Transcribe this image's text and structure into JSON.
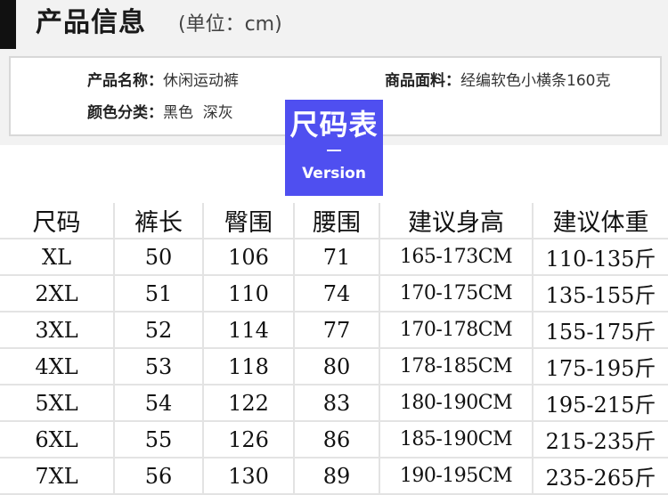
{
  "header": {
    "title": "产品信息",
    "unit": "(单位：cm)"
  },
  "info": {
    "name_label": "产品名称：",
    "name_value": "休闲运动裤",
    "fabric_label": "商品面料：",
    "fabric_value": "经编软色小横条160克",
    "color_label": "颜色分类：",
    "color_value": "黑色  深灰"
  },
  "badge": {
    "title": "尺码表",
    "subtitle": "Version",
    "color": "#4f4ff0"
  },
  "size_table": {
    "headers": [
      "尺码",
      "裤长",
      "臀围",
      "腰围",
      "建议身高",
      "建议体重"
    ],
    "rows": [
      [
        "XL",
        "50",
        "106",
        "71",
        "165-173CM",
        "110-135斤"
      ],
      [
        "2XL",
        "51",
        "110",
        "74",
        "170-175CM",
        "135-155斤"
      ],
      [
        "3XL",
        "52",
        "114",
        "77",
        "170-178CM",
        "155-175斤"
      ],
      [
        "4XL",
        "53",
        "118",
        "80",
        "178-185CM",
        "175-195斤"
      ],
      [
        "5XL",
        "54",
        "122",
        "83",
        "180-190CM",
        "195-215斤"
      ],
      [
        "6XL",
        "55",
        "126",
        "86",
        "185-190CM",
        "215-235斤"
      ],
      [
        "7XL",
        "56",
        "130",
        "89",
        "190-195CM",
        "235-265斤"
      ]
    ]
  }
}
